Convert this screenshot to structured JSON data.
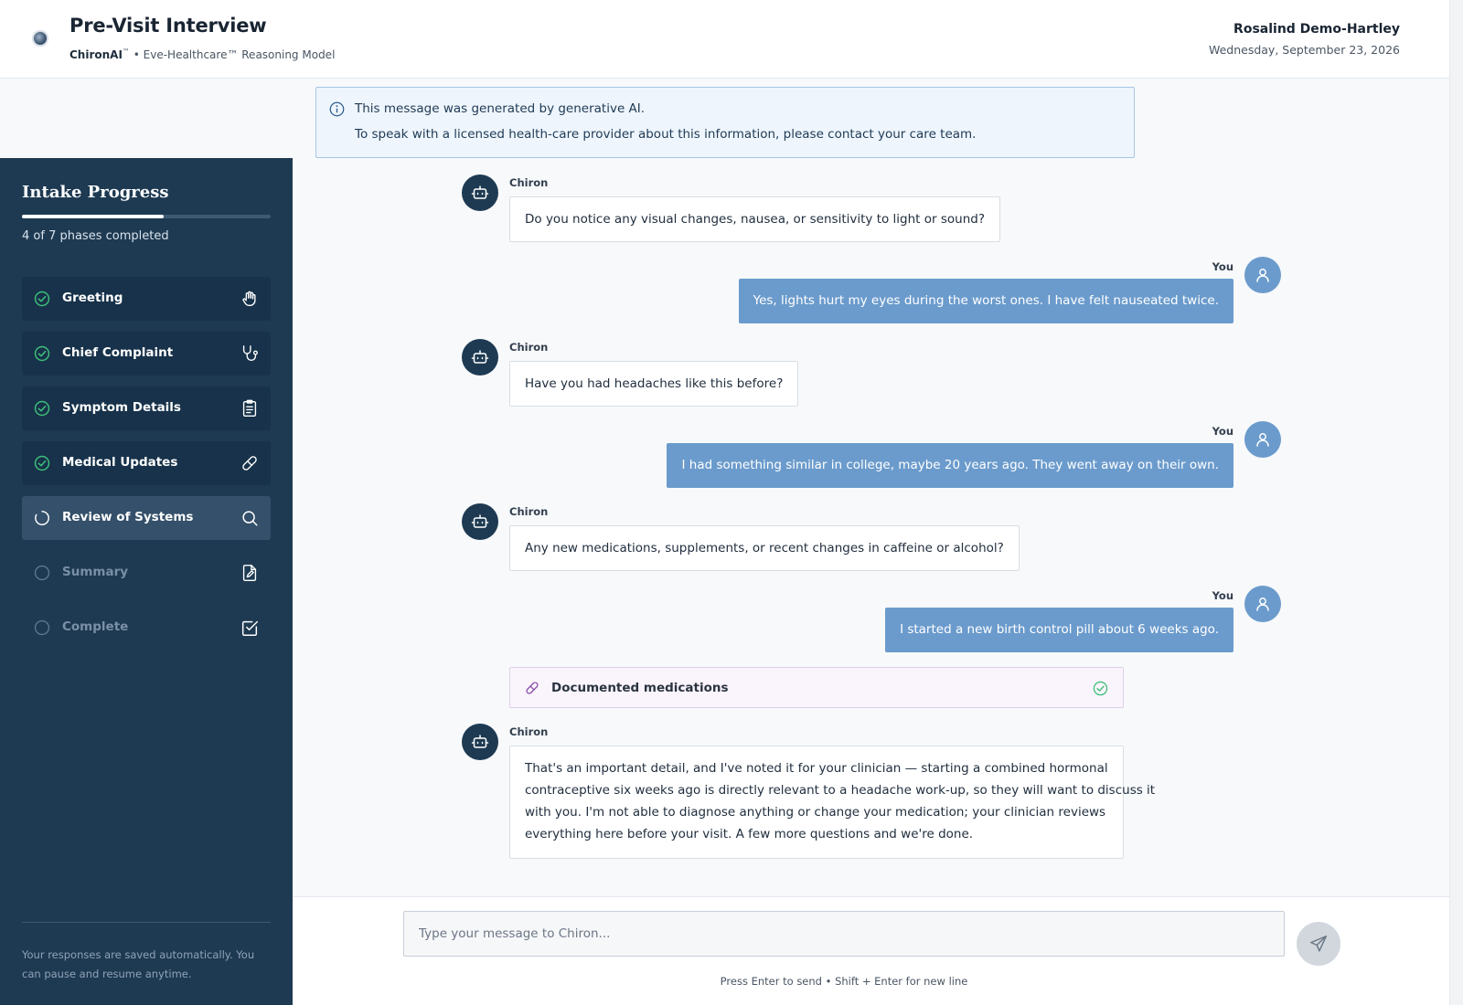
{
  "header": {
    "title": "Pre-Visit Interview",
    "brand": "ChironAI",
    "brand_mark": "™",
    "model": "• Eve-Healthcare™ Reasoning Model",
    "user_name": "Rosalind Demo-Hartley",
    "date": "Wednesday, September 23, 2026"
  },
  "banner": {
    "line1": "This message was generated by generative AI.",
    "line2": "To speak with a licensed health-care provider about this information, please contact your care team."
  },
  "sidebar": {
    "title": "Intake Progress",
    "progress_fraction": 0.571,
    "progress_text": "4 of 7 phases completed",
    "phases": [
      {
        "label": "Greeting",
        "status": "done",
        "icon": "hand-icon"
      },
      {
        "label": "Chief Complaint",
        "status": "done",
        "icon": "stethoscope-icon"
      },
      {
        "label": "Symptom Details",
        "status": "done",
        "icon": "clipboard-icon"
      },
      {
        "label": "Medical Updates",
        "status": "done",
        "icon": "pill-icon"
      },
      {
        "label": "Review of Systems",
        "status": "current",
        "icon": "search-icon"
      },
      {
        "label": "Summary",
        "status": "pending",
        "icon": "document-edit-icon"
      },
      {
        "label": "Complete",
        "status": "pending",
        "icon": "checkbox-icon"
      }
    ],
    "footer": "Your responses are saved automatically. You can pause and resume anytime."
  },
  "chat": {
    "bot_name": "Chiron",
    "user_name": "You",
    "messages": [
      {
        "from": "bot",
        "text": "Do you notice any visual changes, nausea, or sensitivity to light or sound?"
      },
      {
        "from": "user",
        "text": "Yes, lights hurt my eyes during the worst ones. I have felt nauseated twice."
      },
      {
        "from": "bot",
        "text": "Have you had headaches like this before?"
      },
      {
        "from": "user",
        "text": "I had something similar in college, maybe 20 years ago. They went away on their own."
      },
      {
        "from": "bot",
        "text": "Any new medications, supplements, or recent changes in caffeine or alcohol?"
      },
      {
        "from": "user",
        "text": "I started a new birth control pill about 6 weeks ago."
      },
      {
        "from": "bot",
        "lines": [
          "That's an important detail, and I've noted it for your clinician — starting a combined hormonal",
          "contraceptive six weeks ago is directly relevant to a headache work-up, so they will want to discuss it",
          "with you. I'm not able to diagnose anything or change your medication; your clinician reviews",
          "everything here before your visit. A few more questions and we're done."
        ]
      }
    ],
    "tool_card": {
      "label": "Documented medications",
      "status": "complete"
    }
  },
  "composer": {
    "placeholder": "Type your message to Chiron...",
    "value": "",
    "hint": "Press Enter to send • Shift + Enter for new line"
  },
  "colors": {
    "sidebar_bg": "#1e3a52",
    "user_bubble": "#6b9bcc",
    "check_green": "#3ec07a",
    "tool_purple": "#8b4fa8"
  }
}
